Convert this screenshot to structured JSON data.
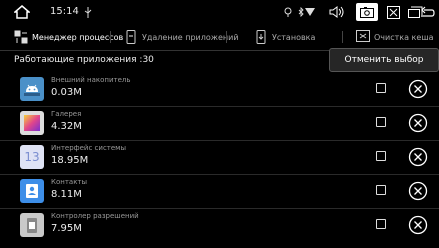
{
  "status_bar": {
    "time": "15:14",
    "icons": [
      "home-icon",
      "usb-icon",
      "location-icon",
      "bluetooth-icon",
      "wifi-icon",
      "volume-icon",
      "screenshot-icon",
      "close-box-icon",
      "recent-apps-icon",
      "back-icon"
    ]
  },
  "tabs": [
    {
      "label": "Менеджер процессов",
      "icon": "process-manager-icon",
      "active": true
    },
    {
      "label": "Удаление приложений",
      "icon": "uninstall-icon",
      "active": false
    },
    {
      "label": "Установка",
      "icon": "install-icon",
      "active": false
    },
    {
      "label": "Очистка кеша",
      "icon": "clear-cache-icon",
      "active": false
    }
  ],
  "running_title": "Работающие приложения :30",
  "cancel_button": "Отменить выбор",
  "apps": [
    {
      "name": "Внешний накопитель",
      "size": "0.03M",
      "icon": "android-icon"
    },
    {
      "name": "Галерея",
      "size": "4.32M",
      "icon": "gallery-icon"
    },
    {
      "name": "Интерфейс системы",
      "size": "18.95M",
      "icon": "system-ui-icon",
      "icon_text": "13"
    },
    {
      "name": "Контакты",
      "size": "8.11M",
      "icon": "contacts-icon"
    },
    {
      "name": "Контролер разрешений",
      "size": "7.95M",
      "icon": "permission-controller-icon"
    }
  ],
  "colors": {
    "background": "#000000",
    "accent_android": "#4a90c8",
    "accent_system_ui": "#7b8ed0",
    "accent_contacts": "#3d8ee8"
  }
}
